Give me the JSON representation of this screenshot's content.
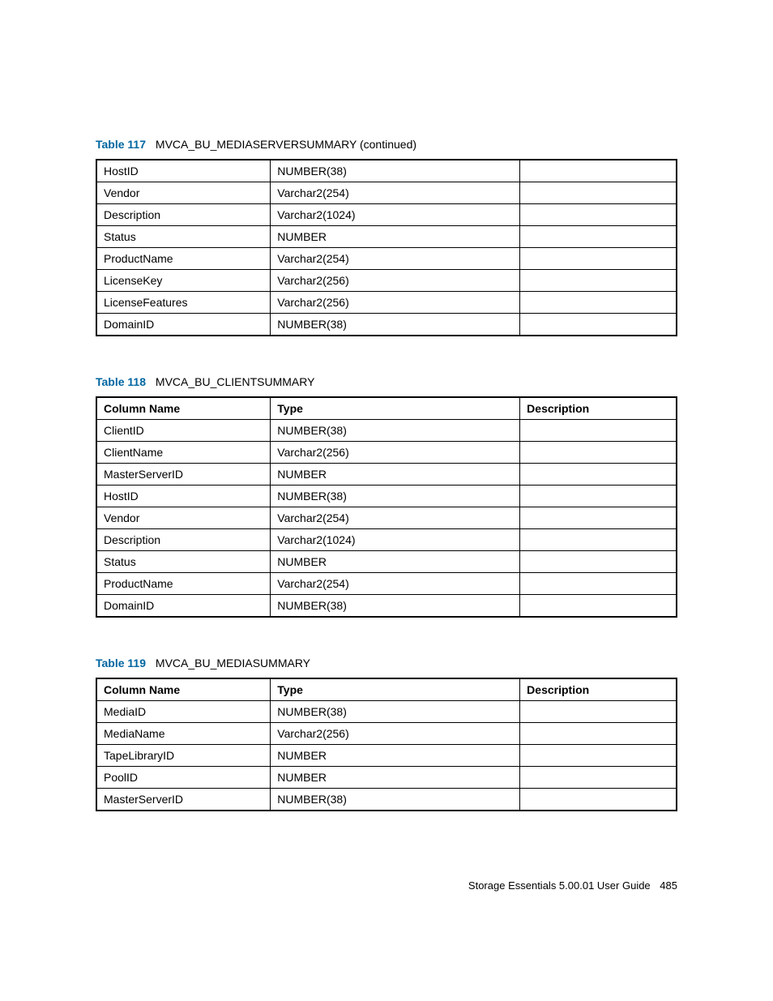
{
  "tables": [
    {
      "label": "Table 117",
      "title": "MVCA_BU_MEDIASERVERSUMMARY (continued)",
      "header": null,
      "rows": [
        [
          "HostID",
          "NUMBER(38)",
          ""
        ],
        [
          "Vendor",
          "Varchar2(254)",
          ""
        ],
        [
          "Description",
          "Varchar2(1024)",
          ""
        ],
        [
          "Status",
          "NUMBER",
          ""
        ],
        [
          "ProductName",
          "Varchar2(254)",
          ""
        ],
        [
          "LicenseKey",
          "Varchar2(256)",
          ""
        ],
        [
          "LicenseFeatures",
          "Varchar2(256)",
          ""
        ],
        [
          "DomainID",
          "NUMBER(38)",
          ""
        ]
      ]
    },
    {
      "label": "Table 118",
      "title": "MVCA_BU_CLIENTSUMMARY",
      "header": [
        "Column Name",
        "Type",
        "Description"
      ],
      "rows": [
        [
          "ClientID",
          "NUMBER(38)",
          ""
        ],
        [
          "ClientName",
          "Varchar2(256)",
          ""
        ],
        [
          "MasterServerID",
          "NUMBER",
          ""
        ],
        [
          "HostID",
          "NUMBER(38)",
          ""
        ],
        [
          "Vendor",
          "Varchar2(254)",
          ""
        ],
        [
          "Description",
          "Varchar2(1024)",
          ""
        ],
        [
          "Status",
          "NUMBER",
          ""
        ],
        [
          "ProductName",
          "Varchar2(254)",
          ""
        ],
        [
          "DomainID",
          "NUMBER(38)",
          ""
        ]
      ]
    },
    {
      "label": "Table 119",
      "title": "MVCA_BU_MEDIASUMMARY",
      "header": [
        "Column Name",
        "Type",
        "Description"
      ],
      "rows": [
        [
          "MediaID",
          "NUMBER(38)",
          ""
        ],
        [
          "MediaName",
          "Varchar2(256)",
          ""
        ],
        [
          "TapeLibraryID",
          "NUMBER",
          ""
        ],
        [
          "PoolID",
          "NUMBER",
          ""
        ],
        [
          "MasterServerID",
          "NUMBER(38)",
          ""
        ]
      ]
    }
  ],
  "footer": {
    "text": "Storage Essentials 5.00.01 User Guide",
    "page": "485"
  }
}
